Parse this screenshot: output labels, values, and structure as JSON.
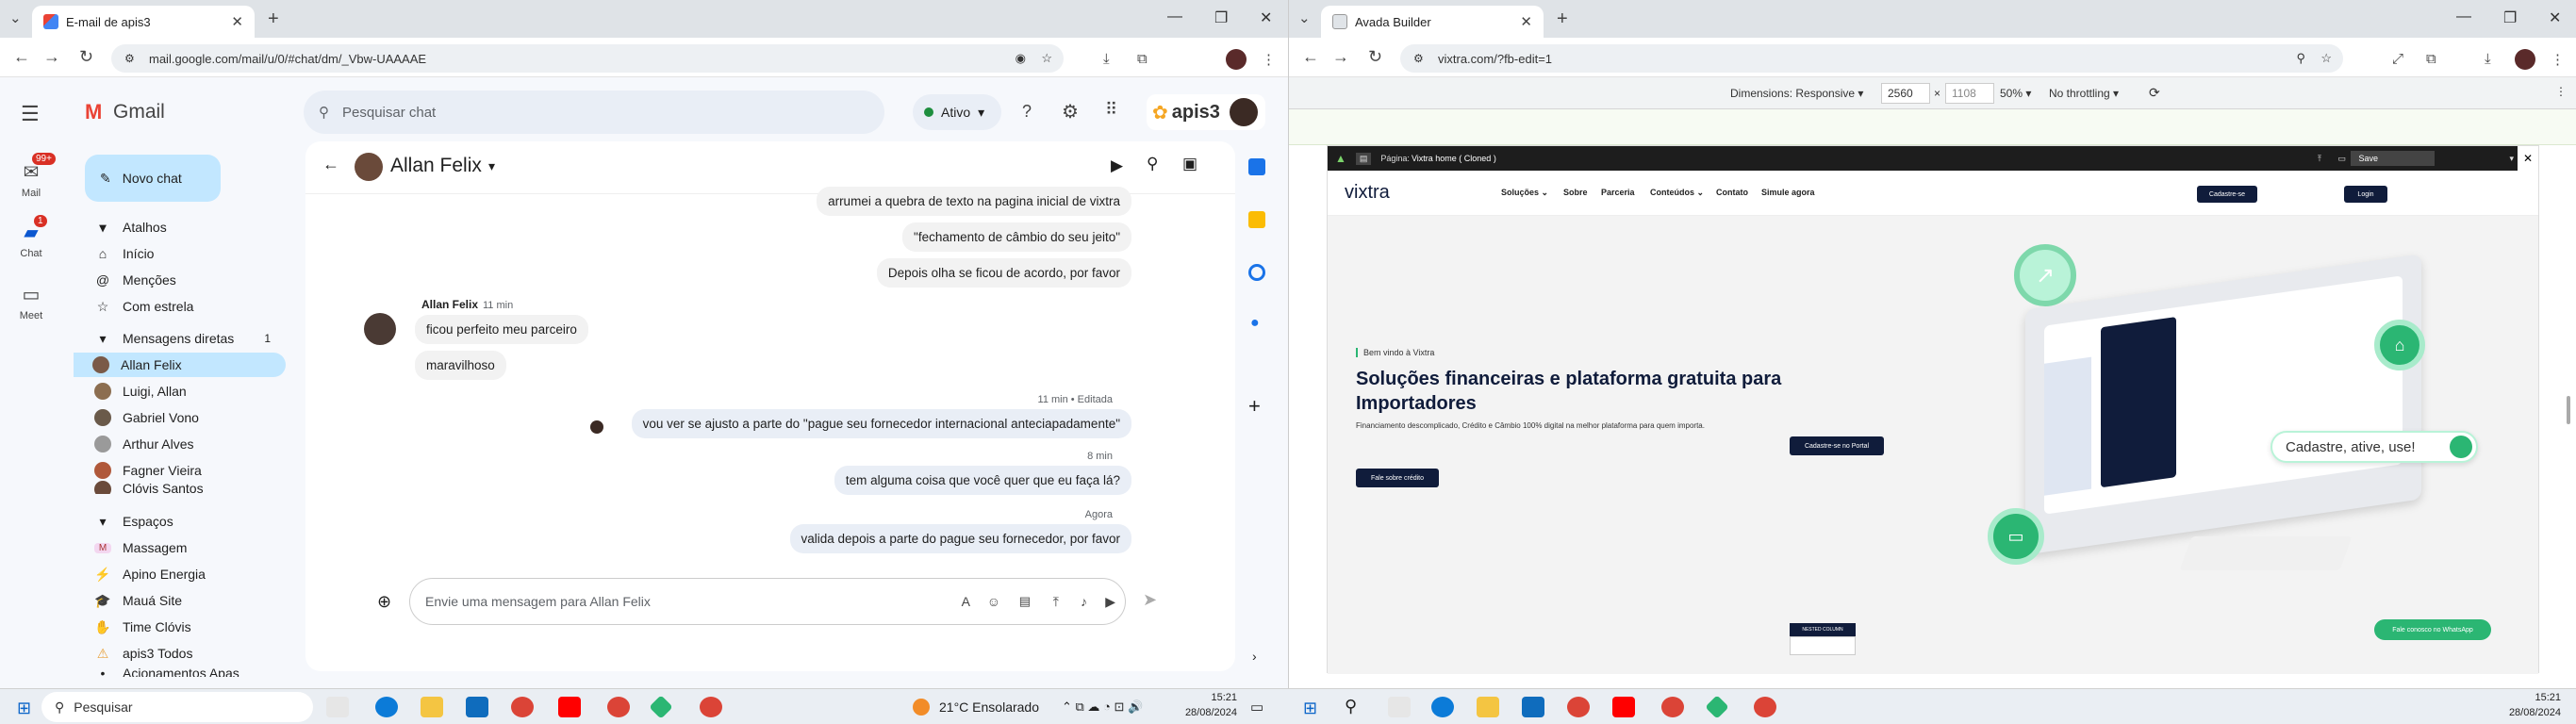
{
  "left": {
    "tab": {
      "title": "E-mail de apis3"
    },
    "url": "mail.google.com/mail/u/0/#chat/dm/_Vbw-UAAAAE",
    "app_name": "Gmail",
    "search_placeholder": "Pesquisar chat",
    "status": "Ativo",
    "account_brand": "apis3",
    "rail": [
      {
        "label": "Mail",
        "badge": "99+"
      },
      {
        "label": "Chat",
        "badge": "1"
      },
      {
        "label": "Meet"
      }
    ],
    "new_chat": "Novo chat",
    "sections": {
      "shortcuts": {
        "title": "Atalhos",
        "items": [
          "Início",
          "Menções",
          "Com estrela"
        ]
      },
      "dms": {
        "title": "Mensagens diretas",
        "count": "1",
        "items": [
          "Allan Felix",
          "Luigi, Allan",
          "Gabriel Vono",
          "Arthur Alves",
          "Fagner Vieira",
          "Clóvis Santos"
        ]
      },
      "spaces": {
        "title": "Espaços",
        "items": [
          "Massagem",
          "Apino Energia",
          "Mauá Site",
          "Time Clóvis",
          "apis3 Todos",
          "Acionamentos Apas"
        ]
      }
    },
    "chat": {
      "contact": "Allan Felix",
      "messages_top": [
        "arrumei a quebra de texto na pagina inicial de vixtra",
        "\"fechamento de câmbio do seu jeito\"",
        "Depois olha se ficou de acordo, por favor"
      ],
      "sender_name": "Allan Felix",
      "sender_time": "11 min",
      "incoming": [
        "ficou perfeito meu parceiro",
        "maravilhoso"
      ],
      "edit_meta": "11 min • Editada",
      "out1": "vou ver se ajusto a parte do \"pague seu fornecedor internacional anteciapadamente\"",
      "time2": "8 min",
      "out2": "tem alguma coisa que você quer que eu faça lá?",
      "time3": "Agora",
      "out3": "valida depois a parte do pague seu fornecedor, por favor",
      "composer_placeholder": "Envie uma mensagem para Allan Felix"
    }
  },
  "right": {
    "tab": {
      "title": "Avada Builder"
    },
    "url": "vixtra.com/?fb-edit=1",
    "devtools": {
      "dimensions_label": "Dimensions: Responsive",
      "width": "2560",
      "height": "1108",
      "zoom": "50%",
      "throttling": "No throttling"
    },
    "builder": {
      "page_label": "Página:",
      "page_name": "Vixtra home ( Cloned )",
      "save": "Save"
    },
    "site": {
      "logo": "vixtra",
      "menu": [
        "Soluções",
        "Sobre",
        "Parceria",
        "Conteúdos",
        "Contato",
        "Simule agora"
      ],
      "signup": "Cadastre-se",
      "login": "Login",
      "welcome": "Bem vindo à Vixtra",
      "headline": "Soluções financeiras e plataforma gratuita para Importadores",
      "sub": "Financiamento descomplicado, Crédito e Câmbio 100% digital na melhor plataforma para quem importa.",
      "portal_btn": "Cadastre-se no Portal",
      "credit_btn": "Fale sobre crédito",
      "pill": "Cadastre, ative, use!",
      "nested": "NESTED COLUMN",
      "whatsapp": "Fale conosco no WhatsApp"
    }
  },
  "taskbar": {
    "search": "Pesquisar",
    "weather": "21°C  Ensolarado",
    "time": "15:21",
    "date": "28/08/2024"
  },
  "colors": {
    "accent": "#0b57d0",
    "selected": "#c2e7ff",
    "brand_dark": "#101c3b",
    "green": "#2bb673"
  }
}
